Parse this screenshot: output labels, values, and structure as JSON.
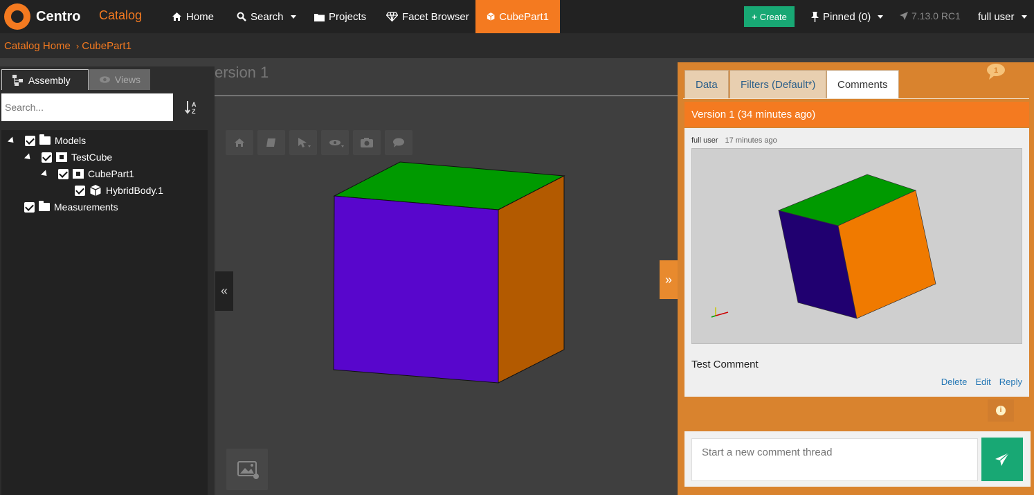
{
  "navbar": {
    "brand": "Centro",
    "catalog": "Catalog",
    "home": "Home",
    "search": "Search",
    "projects": "Projects",
    "facet_browser": "Facet Browser",
    "active_tab": "CubePart1",
    "create": "Create",
    "pinned": "Pinned (0)",
    "version": "7.13.0 RC1",
    "user": "full user"
  },
  "breadcrumb": {
    "home": "Catalog Home",
    "current": "CubePart1"
  },
  "page": {
    "title_visible": "ersion 1"
  },
  "left_panel": {
    "tab_assembly": "Assembly",
    "tab_views": "Views",
    "search_placeholder": "Search...",
    "tree": [
      {
        "label": "Models"
      },
      {
        "label": "TestCube"
      },
      {
        "label": "CubePart1"
      },
      {
        "label": "HybridBody.1"
      },
      {
        "label": "Measurements"
      }
    ]
  },
  "right_panel": {
    "tabs": [
      "Data",
      "Filters (Default*)",
      "Comments"
    ],
    "version_header": "Version 1 (34 minutes ago)",
    "comment": {
      "author": "full user",
      "time": "17 minutes ago",
      "text": "Test Comment",
      "actions": [
        "Delete",
        "Edit",
        "Reply"
      ]
    },
    "new_thread_placeholder": "Start a new comment thread"
  },
  "colors": {
    "accent": "#f47a20",
    "panel": "#d9832e",
    "create": "#18a874",
    "cube_top": "#009a00",
    "cube_front": "#5806cc",
    "cube_side": "#b35a00"
  }
}
